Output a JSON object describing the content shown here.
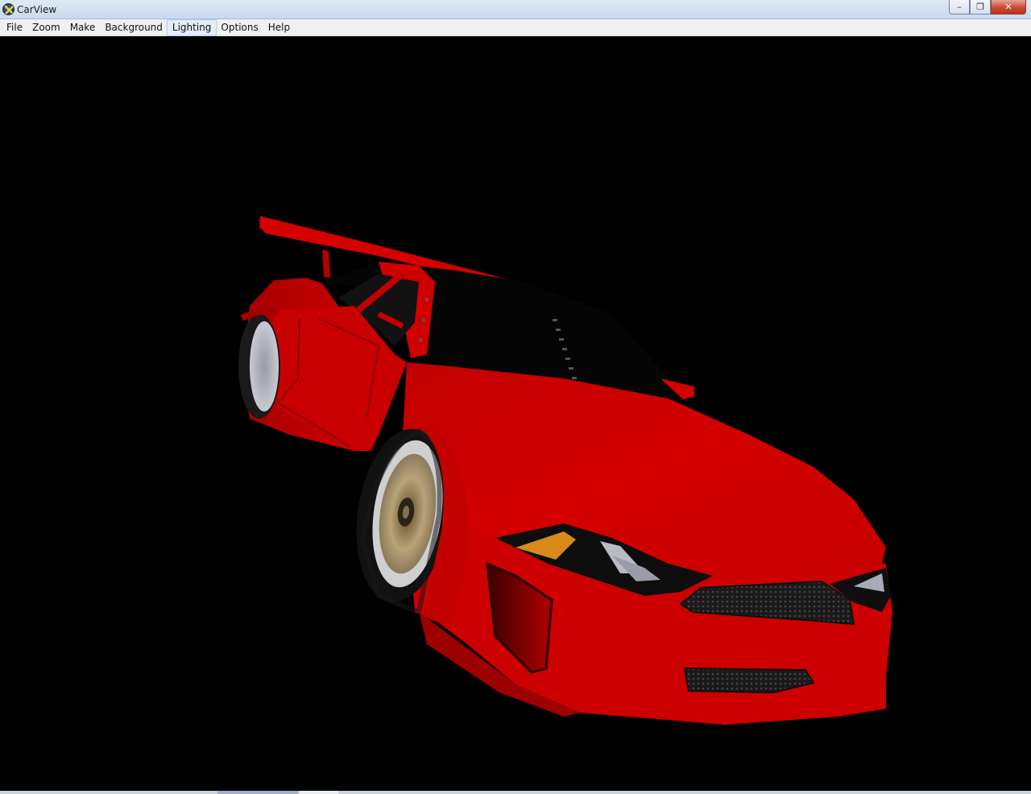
{
  "window": {
    "title": "CarView",
    "controls": {
      "minimize": "–",
      "maximize": "❐",
      "close": "✕"
    }
  },
  "menu": {
    "items": [
      {
        "label": "File"
      },
      {
        "label": "Zoom"
      },
      {
        "label": "Make"
      },
      {
        "label": "Background"
      },
      {
        "label": "Lighting",
        "active": true
      },
      {
        "label": "Options"
      },
      {
        "label": "Help"
      }
    ]
  },
  "viewport": {
    "background_color": "#000000",
    "car_color": "#d00000"
  }
}
